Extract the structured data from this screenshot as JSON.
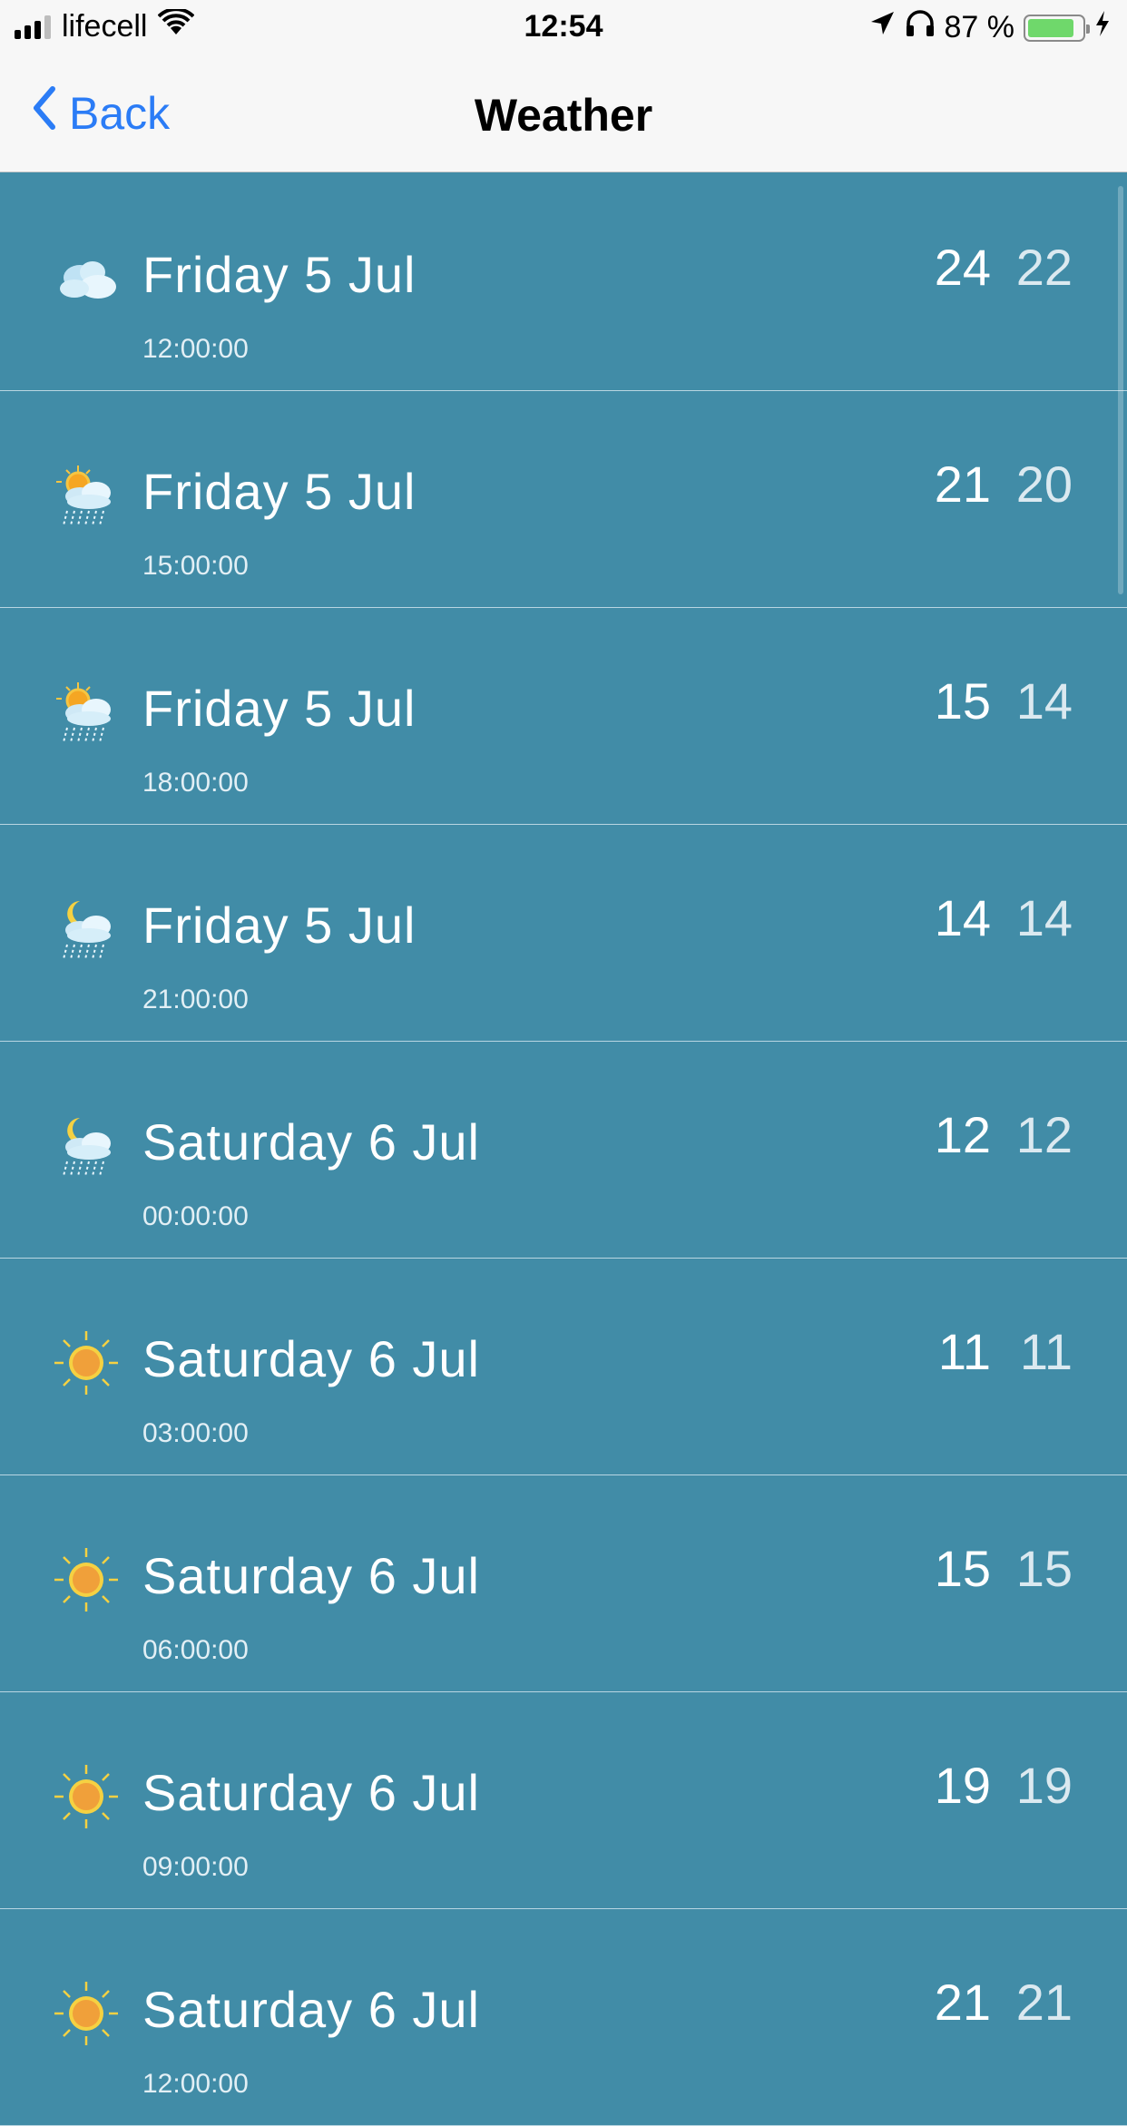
{
  "status_bar": {
    "carrier": "lifecell",
    "time": "12:54",
    "battery_percent_text": "87 %",
    "battery_level": 0.87
  },
  "nav": {
    "back_label": "Back",
    "title": "Weather"
  },
  "forecast": [
    {
      "date": "Friday 5 Jul",
      "time": "12:00:00",
      "hi": "24",
      "lo": "22",
      "icon": "cloudy-icon"
    },
    {
      "date": "Friday 5 Jul",
      "time": "15:00:00",
      "hi": "21",
      "lo": "20",
      "icon": "sun-cloud-rain-icon"
    },
    {
      "date": "Friday 5 Jul",
      "time": "18:00:00",
      "hi": "15",
      "lo": "14",
      "icon": "sun-cloud-rain-icon"
    },
    {
      "date": "Friday 5 Jul",
      "time": "21:00:00",
      "hi": "14",
      "lo": "14",
      "icon": "moon-cloud-rain-icon"
    },
    {
      "date": "Saturday 6 Jul",
      "time": "00:00:00",
      "hi": "12",
      "lo": "12",
      "icon": "moon-cloud-rain-icon"
    },
    {
      "date": "Saturday 6 Jul",
      "time": "03:00:00",
      "hi": "11",
      "lo": "11",
      "icon": "sun-icon"
    },
    {
      "date": "Saturday 6 Jul",
      "time": "06:00:00",
      "hi": "15",
      "lo": "15",
      "icon": "sun-icon"
    },
    {
      "date": "Saturday 6 Jul",
      "time": "09:00:00",
      "hi": "19",
      "lo": "19",
      "icon": "sun-icon"
    },
    {
      "date": "Saturday 6 Jul",
      "time": "12:00:00",
      "hi": "21",
      "lo": "21",
      "icon": "sun-icon"
    }
  ],
  "colors": {
    "list_background": "#418ca7",
    "accent": "#2b7cf6"
  }
}
